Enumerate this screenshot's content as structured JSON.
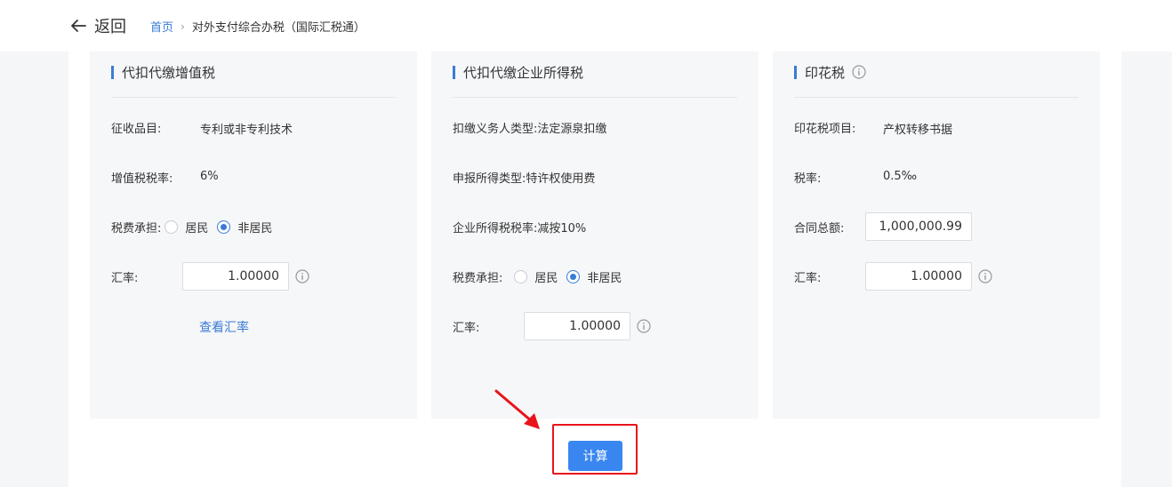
{
  "header": {
    "back_label": "返回",
    "breadcrumb_home": "首页",
    "breadcrumb_current": "对外支付综合办税（国际汇税通）"
  },
  "vat_card": {
    "title": "代扣代缴增值税",
    "item_label": "征收品目:",
    "item_value": "专利或非专利技术",
    "rate_label": "增值税税率:",
    "rate_value": "6%",
    "bearer_label": "税费承担:",
    "bearer_options": [
      "居民",
      "非居民"
    ],
    "bearer_selected": "非居民",
    "exchange_label": "汇率:",
    "exchange_value": "1.00000",
    "view_rate_link": "查看汇率"
  },
  "cit_card": {
    "title": "代扣代缴企业所得税",
    "obligor_label": "扣缴义务人类型:",
    "obligor_value": "法定源泉扣缴",
    "income_label": "申报所得类型:",
    "income_value": "特许权使用费",
    "rate_label": "企业所得税税率:",
    "rate_value": "减按10%",
    "bearer_label": "税费承担:",
    "bearer_options": [
      "居民",
      "非居民"
    ],
    "bearer_selected": "非居民",
    "exchange_label": "汇率:",
    "exchange_value": "1.00000"
  },
  "stamp_card": {
    "title": "印花税",
    "item_label": "印花税项目:",
    "item_value": "产权转移书据",
    "rate_label": "税率:",
    "rate_value": "0.5‰",
    "amount_label": "合同总额:",
    "amount_value": "1,000,000.99",
    "exchange_label": "汇率:",
    "exchange_value": "1.00000"
  },
  "actions": {
    "calculate_label": "计算"
  },
  "colors": {
    "accent": "#3a7bd5",
    "button": "#3a86f0",
    "highlight": "#e8141b"
  }
}
